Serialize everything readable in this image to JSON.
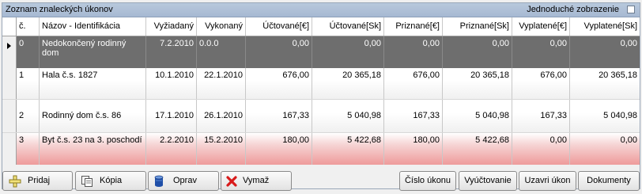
{
  "panel": {
    "title": "Zoznam znaleckých úkonov",
    "simple_view_label": "Jednoduché zobrazenie"
  },
  "table": {
    "headers": [
      "č.",
      "Názov - Identifikácia",
      "Vyžiadaný",
      "Vykonaný",
      "Účtované[€]",
      "Účtované[Sk]",
      "Priznané[€]",
      "Priznané[Sk]",
      "Vyplatené[€]",
      "Vyplatené[Sk]"
    ],
    "rows": [
      [
        "0",
        "Nedokončený rodinný dom",
        "7.2.2010",
        "0.0.0",
        "0,00",
        "0,00",
        "0,00",
        "0,00",
        "0,00",
        "0,00"
      ],
      [
        "1",
        "Hala č.s. 1827",
        "10.1.2010",
        "22.1.2010",
        "676,00",
        "20 365,18",
        "676,00",
        "20 365,18",
        "676,00",
        "20 365,18"
      ],
      [
        "2",
        "Rodinný dom č.s. 86",
        "17.1.2010",
        "26.1.2010",
        "167,33",
        "5 040,98",
        "167,33",
        "5 040,98",
        "167,33",
        "5 040,98"
      ],
      [
        "3",
        "Byt č.s. 23 na 3. poschodí",
        "2.2.2010",
        "15.2.2010",
        "180,00",
        "5 422,68",
        "180,00",
        "5 422,68",
        "0,00",
        "0,00"
      ]
    ]
  },
  "buttons": {
    "add": "Pridaj",
    "copy": "Kópia",
    "edit": "Oprav",
    "delete": "Vymaž",
    "act_number": "Číslo úkonu",
    "billing": "Vyúčtovanie",
    "close_act": "Uzavri úkon",
    "documents": "Dokumenty"
  },
  "colors": {
    "selected_row": "#6e6e6e",
    "unpaid_row": "#ee9a9a",
    "title_bar": "#b8c8dc"
  },
  "icons": [
    "add-icon",
    "copy-icon",
    "database-icon",
    "delete-icon"
  ]
}
